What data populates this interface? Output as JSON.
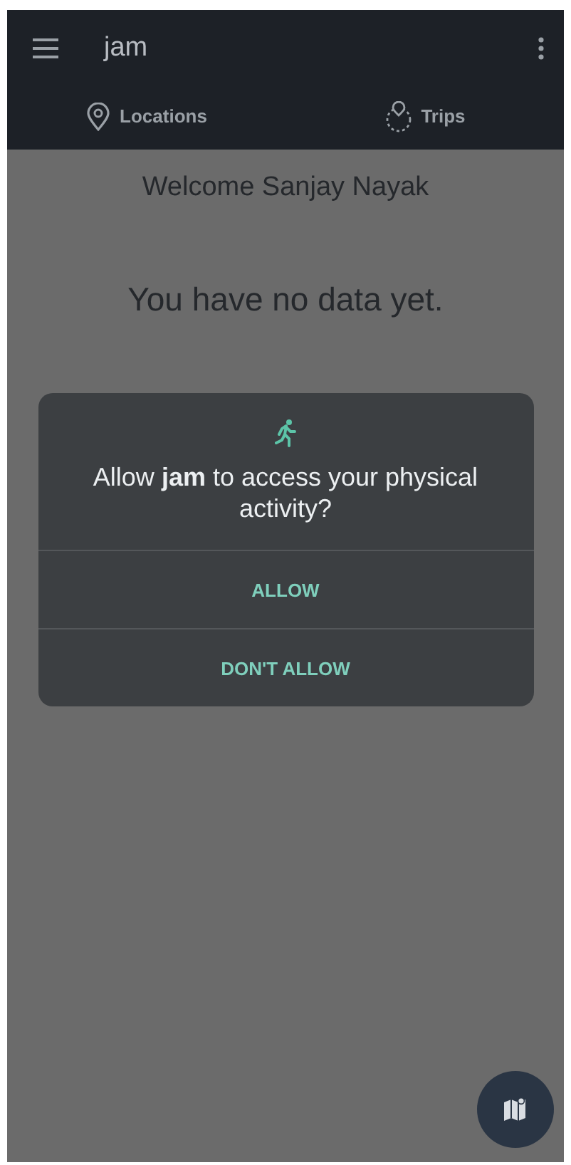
{
  "app_bar": {
    "title": "jam"
  },
  "tabs": [
    {
      "label": "Locations",
      "kind": "pin",
      "selected": false
    },
    {
      "label": "Trips",
      "kind": "trips",
      "selected": false
    }
  ],
  "welcome": "Welcome Sanjay Nayak",
  "empty_message": "You have no data yet.",
  "dialog": {
    "message": "Allow **jam** to access your physical activity?",
    "buttons": [
      "ALLOW",
      "DON'T ALLOW"
    ]
  }
}
